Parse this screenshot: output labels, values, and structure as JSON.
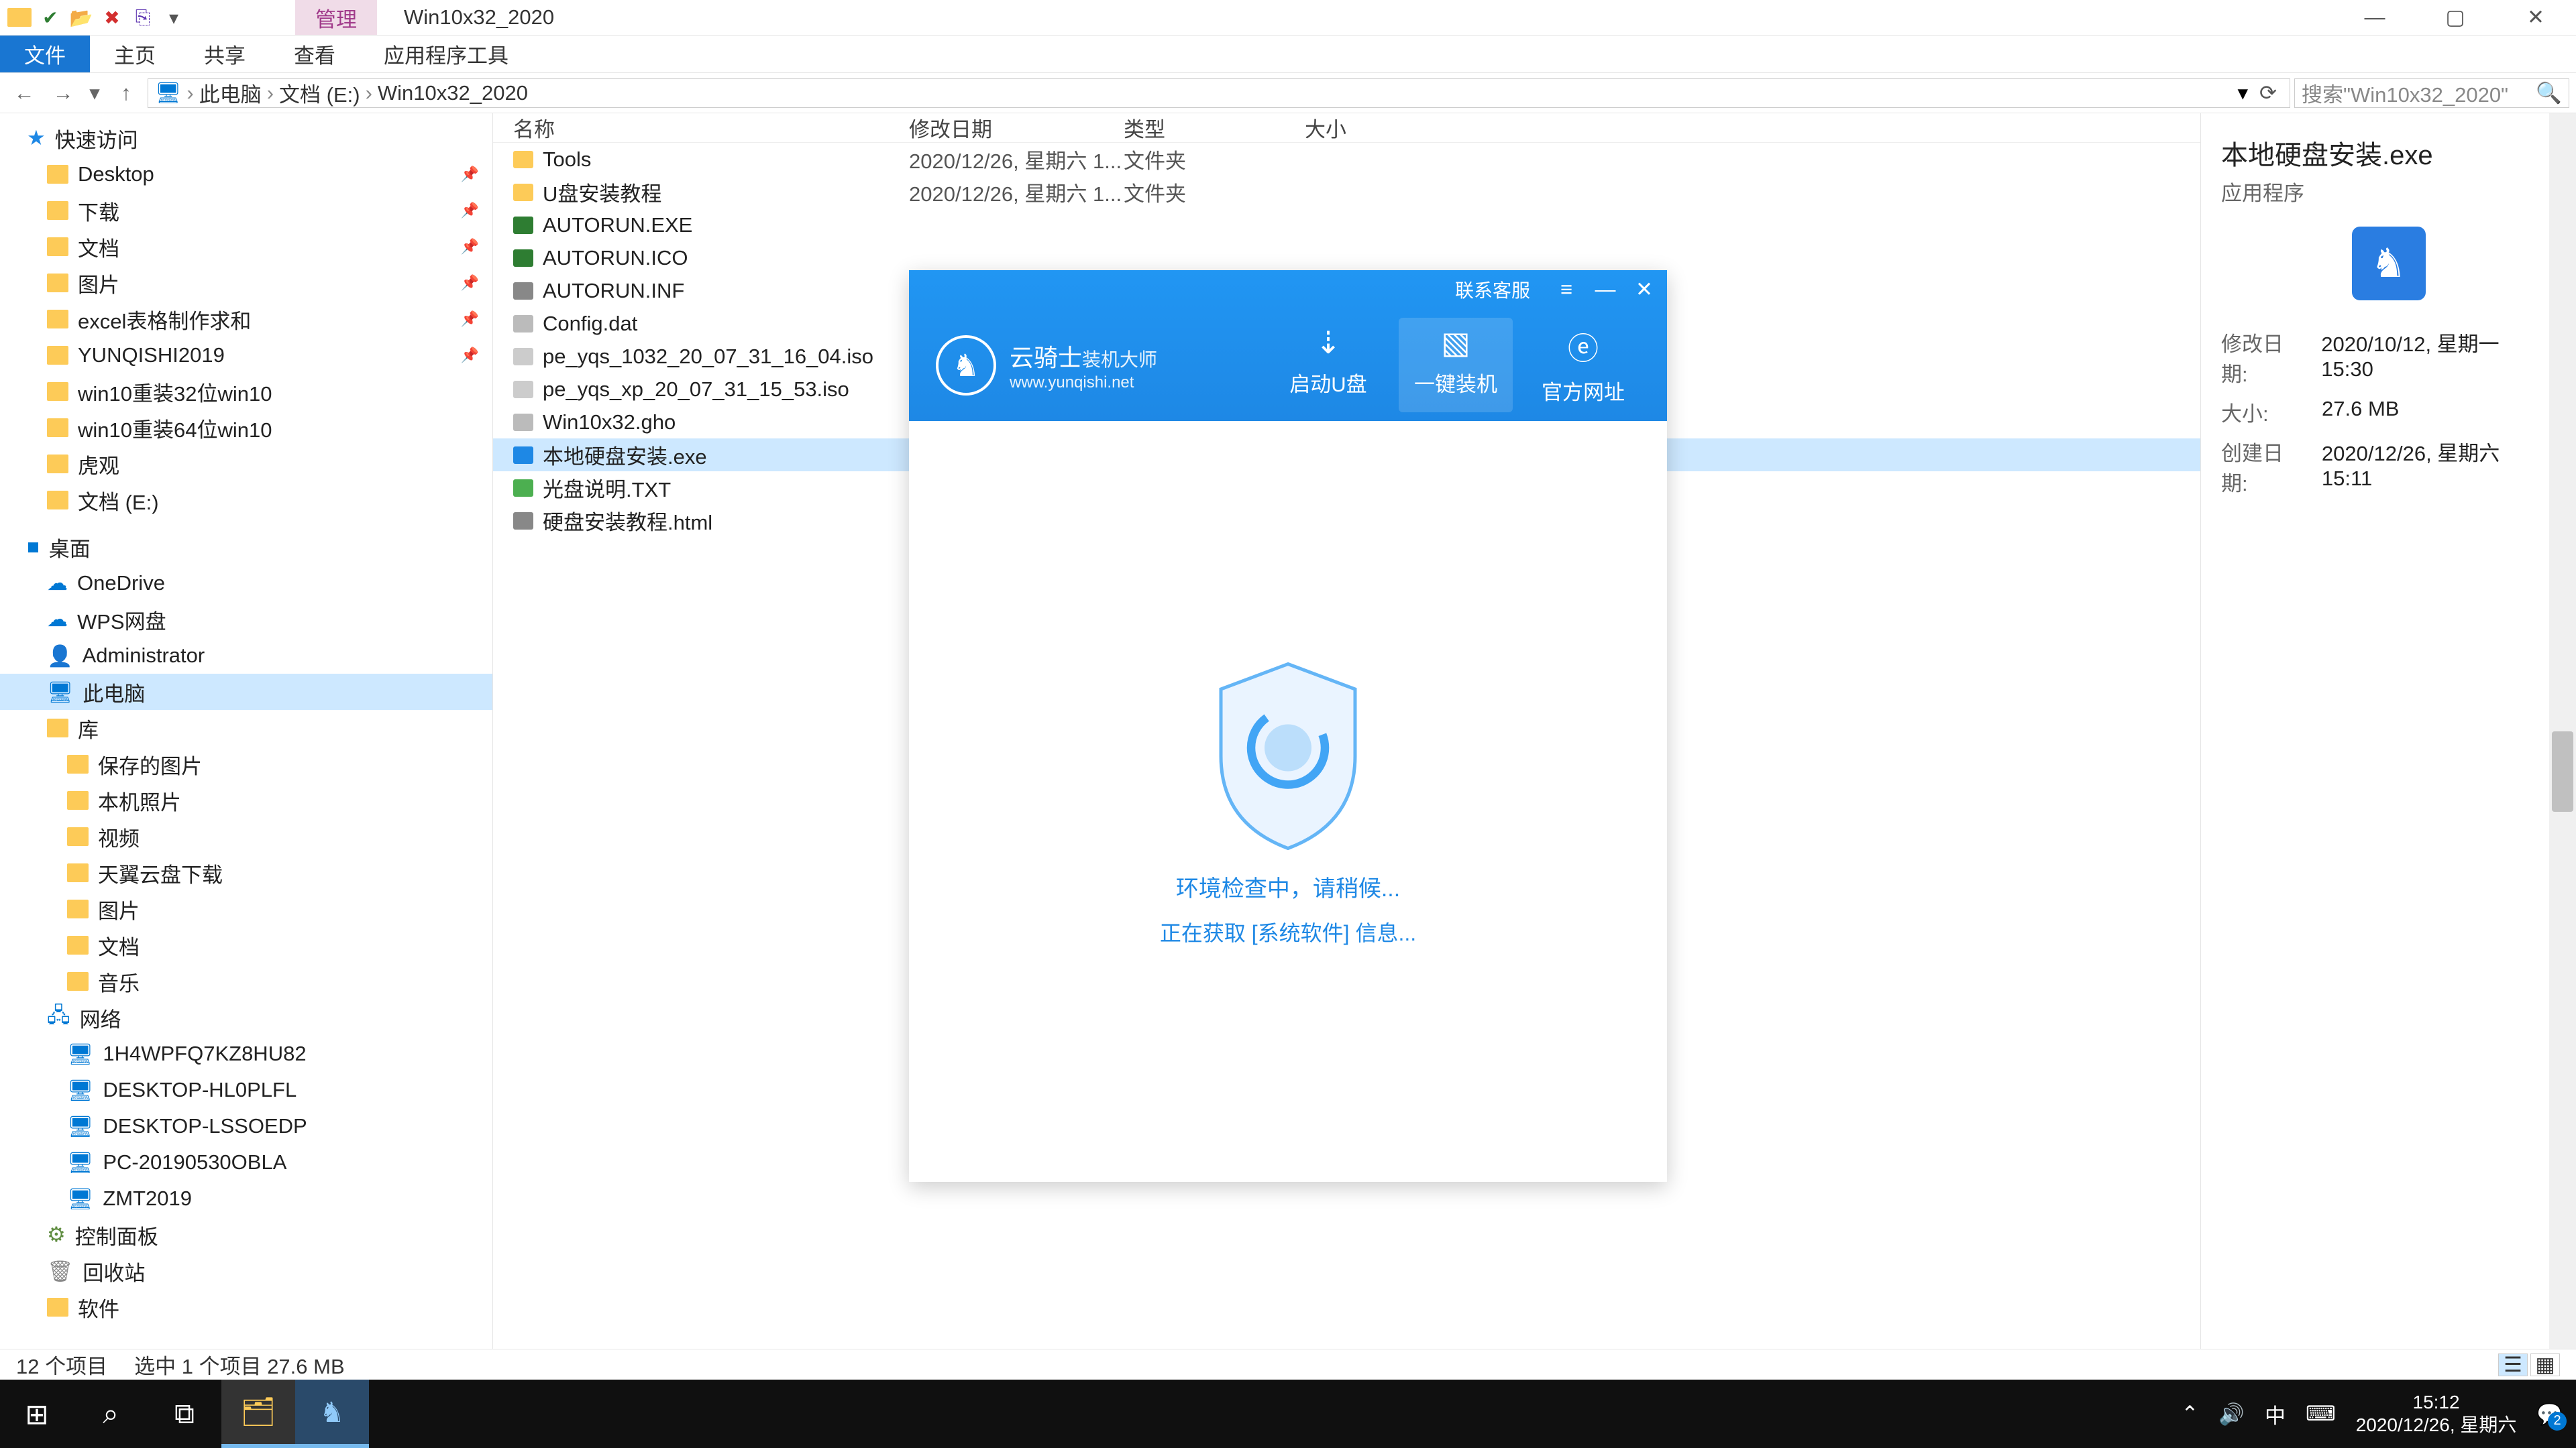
{
  "titlebar": {
    "context_tab": "管理",
    "window_title": "Win10x32_2020"
  },
  "ribbon": {
    "file": "文件",
    "home": "主页",
    "share": "共享",
    "view": "查看",
    "tools": "应用程序工具"
  },
  "breadcrumb": {
    "items": [
      "此电脑",
      "文档 (E:)",
      "Win10x32_2020"
    ]
  },
  "search": {
    "placeholder": "搜索\"Win10x32_2020\""
  },
  "nav_tree": {
    "quick_access": "快速访问",
    "qa_items": [
      {
        "label": "Desktop",
        "pin": true
      },
      {
        "label": "下载",
        "pin": true
      },
      {
        "label": "文档",
        "pin": true
      },
      {
        "label": "图片",
        "pin": true
      },
      {
        "label": "excel表格制作求和",
        "pin": true
      },
      {
        "label": "YUNQISHI2019",
        "pin": true
      },
      {
        "label": "win10重装32位win10",
        "pin": false
      },
      {
        "label": "win10重装64位win10",
        "pin": false
      },
      {
        "label": "虎观",
        "pin": false
      },
      {
        "label": "文档 (E:)",
        "pin": false
      }
    ],
    "desktop": "桌面",
    "desktop_items": [
      "OneDrive",
      "WPS网盘",
      "Administrator",
      "此电脑",
      "库"
    ],
    "lib_items": [
      "保存的图片",
      "本机照片",
      "视频",
      "天翼云盘下载",
      "图片",
      "文档",
      "音乐"
    ],
    "network": "网络",
    "net_items": [
      "1H4WPFQ7KZ8HU82",
      "DESKTOP-HL0PLFL",
      "DESKTOP-LSSOEDP",
      "PC-20190530OBLA",
      "ZMT2019"
    ],
    "control_panel": "控制面板",
    "recycle": "回收站",
    "software": "软件"
  },
  "columns": {
    "name": "名称",
    "date": "修改日期",
    "type": "类型",
    "size": "大小"
  },
  "files": [
    {
      "name": "Tools",
      "date": "2020/12/26, 星期六 1...",
      "type": "文件夹",
      "icon": "folder"
    },
    {
      "name": "U盘安装教程",
      "date": "2020/12/26, 星期六 1...",
      "type": "文件夹",
      "icon": "folder"
    },
    {
      "name": "AUTORUN.EXE",
      "date": "",
      "type": "",
      "icon": "exe-green"
    },
    {
      "name": "AUTORUN.ICO",
      "date": "",
      "type": "",
      "icon": "exe-green"
    },
    {
      "name": "AUTORUN.INF",
      "date": "",
      "type": "",
      "icon": "inf"
    },
    {
      "name": "Config.dat",
      "date": "",
      "type": "",
      "icon": "file"
    },
    {
      "name": "pe_yqs_1032_20_07_31_16_04.iso",
      "date": "",
      "type": "",
      "icon": "iso"
    },
    {
      "name": "pe_yqs_xp_20_07_31_15_53.iso",
      "date": "",
      "type": "",
      "icon": "iso"
    },
    {
      "name": "Win10x32.gho",
      "date": "",
      "type": "",
      "icon": "file"
    },
    {
      "name": "本地硬盘安装.exe",
      "date": "",
      "type": "",
      "icon": "exe-blue",
      "selected": true
    },
    {
      "name": "光盘说明.TXT",
      "date": "",
      "type": "",
      "icon": "txt"
    },
    {
      "name": "硬盘安装教程.html",
      "date": "",
      "type": "",
      "icon": "html"
    }
  ],
  "details": {
    "title": "本地硬盘安装.exe",
    "sub": "应用程序",
    "rows": [
      {
        "label": "修改日期:",
        "value": "2020/10/12, 星期一 15:30"
      },
      {
        "label": "大小:",
        "value": "27.6 MB"
      },
      {
        "label": "创建日期:",
        "value": "2020/12/26, 星期六 15:11"
      }
    ]
  },
  "status": {
    "count": "12 个项目",
    "selected": "选中 1 个项目  27.6 MB"
  },
  "overlay": {
    "contact": "联系客服",
    "brand1": "云骑士",
    "brand2": "装机大师",
    "brand_url": "www.yunqishi.net",
    "tabs": [
      {
        "label": "启动U盘"
      },
      {
        "label": "一键装机",
        "active": true
      },
      {
        "label": "官方网址"
      }
    ],
    "text1": "环境检查中，请稍候...",
    "text2": "正在获取 [系统软件] 信息..."
  },
  "taskbar": {
    "time": "15:12",
    "date": "2020/12/26, 星期六",
    "ime": "中",
    "notif_count": "2"
  }
}
